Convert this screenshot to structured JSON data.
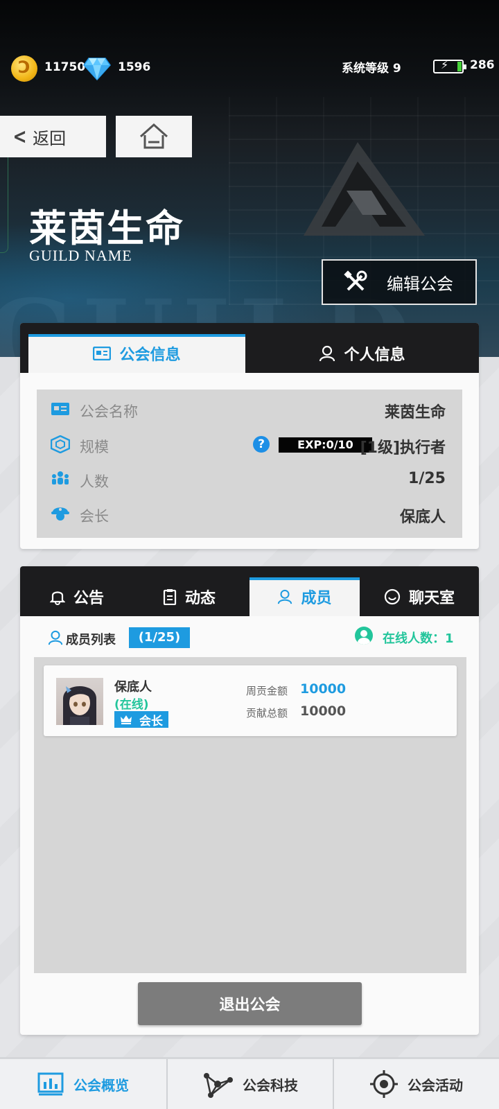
{
  "status_bar": {
    "coins": "11750",
    "gems": "1596",
    "system_level": "系统等级 9",
    "energy": "286"
  },
  "header": {
    "back_label": "返回",
    "guild_name": "莱茵生命",
    "guild_name_sub": "GUILD NAME",
    "edit_button": "编辑公会"
  },
  "info_tabs": [
    {
      "label": "公会信息",
      "active": true
    },
    {
      "label": "个人信息",
      "active": false
    }
  ],
  "guild_info": {
    "rows": [
      {
        "label": "公会名称",
        "value": "莱茵生命",
        "icon": "id-card-icon"
      },
      {
        "label": "规模",
        "value": "[1级]执行者",
        "icon": "cube-icon"
      },
      {
        "label": "人数",
        "value": "1/25",
        "icon": "people-icon"
      },
      {
        "label": "会长",
        "value": "保底人",
        "icon": "leader-icon"
      }
    ],
    "help_glyph": "?",
    "exp": "EXP:0/10",
    "exp_progress": 0.0
  },
  "member_tabs": [
    {
      "label": "公告",
      "active": false,
      "icon": "bell-icon"
    },
    {
      "label": "动态",
      "active": false,
      "icon": "clipboard-icon"
    },
    {
      "label": "成员",
      "active": true,
      "icon": "person-icon"
    },
    {
      "label": "聊天室",
      "active": false,
      "icon": "chat-icon"
    }
  ],
  "member_list": {
    "title": "成员列表",
    "count": "(1/25)",
    "online_text": "在线人数：1",
    "members": [
      {
        "name": "保底人",
        "status": "(在线)",
        "role": "会长",
        "weekly_label": "周贡金额",
        "weekly_value": "10000",
        "total_label": "贡献总额",
        "total_value": "10000"
      }
    ],
    "quit_button": "退出公会"
  },
  "bottom_nav": [
    {
      "label": "公会概览",
      "active": true,
      "icon": "bar-chart-icon"
    },
    {
      "label": "公会科技",
      "active": false,
      "icon": "network-icon"
    },
    {
      "label": "公会活动",
      "active": false,
      "icon": "target-icon"
    }
  ],
  "colors": {
    "accent": "#1e9be0",
    "online": "#22c59b",
    "tab_bar": "#1c1c1e"
  }
}
